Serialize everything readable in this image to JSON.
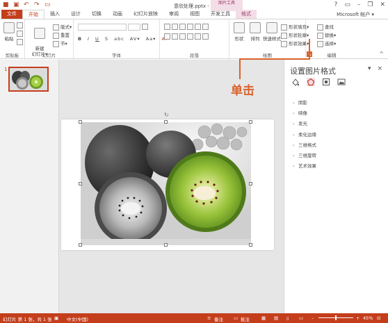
{
  "titlebar": {
    "title": "意欣处理.pptx - PowerPoint",
    "context_group": "图片工具",
    "quick_access": [
      "save-icon",
      "undo-icon",
      "redo-icon",
      "present-icon"
    ],
    "window_controls": [
      "?",
      "▭",
      "–",
      "❐",
      "✕"
    ]
  },
  "tabs": [
    "文件",
    "开始",
    "插入",
    "设计",
    "切换",
    "动画",
    "幻灯片放映",
    "审阅",
    "视图",
    "开发工具",
    "格式"
  ],
  "active_tab": "开始",
  "account": "Microsoft 帐户 ▾",
  "ribbon": {
    "clipboard": {
      "group": "剪贴板",
      "paste": "粘贴"
    },
    "slides": {
      "group": "幻灯片",
      "new_slide": "新建\n幻灯片▾",
      "layout": "版式▾",
      "reset": "重置",
      "section": "节▾"
    },
    "font": {
      "group": "字体",
      "buttons": [
        "B",
        "I",
        "U",
        "S",
        "abc",
        "AV▾",
        "Aa▾",
        "A▾"
      ]
    },
    "paragraph": {
      "group": "段落"
    },
    "drawing": {
      "group": "绘图",
      "shapes": "形状",
      "arrange": "排列",
      "quick_styles": "快速样式",
      "fill": "形状填充▾",
      "outline": "形状轮廓▾",
      "effects": "形状效果▾"
    },
    "editing": {
      "group": "编辑",
      "find": "查找",
      "replace": "替换▾",
      "select": "选择▾"
    }
  },
  "thumbnail": {
    "number": "1"
  },
  "panel": {
    "title": "设置图片格式",
    "close": "×",
    "dropdown": "▾",
    "icons": [
      "fill-line-icon",
      "effects-icon",
      "size-properties-icon",
      "picture-icon"
    ],
    "items": [
      "阴影",
      "映像",
      "发光",
      "柔化边缘",
      "三维格式",
      "三维旋转",
      "艺术效果"
    ]
  },
  "callout": {
    "text": "单击"
  },
  "statusbar": {
    "slide_info": "幻灯片 第 1 张，共 1 张",
    "language": "中文(中国)",
    "notes": "备注",
    "comments": "批注",
    "zoom": "45%"
  },
  "colors": {
    "accent": "#c43e1c",
    "callout": "#d9622b",
    "context_tab": "#f3dde6",
    "kiwi_green": "#7fb72c"
  }
}
